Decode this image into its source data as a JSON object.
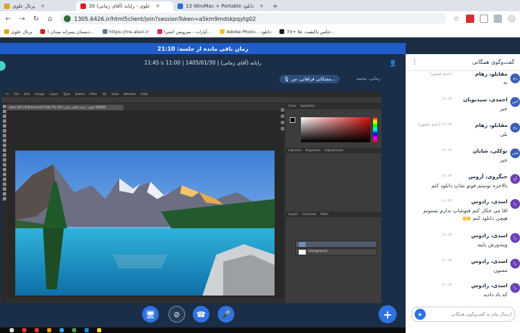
{
  "browser": {
    "tabs": [
      {
        "label": "پرتال علوی"
      },
      {
        "label": "علوی - رایانه (آقای زمانی) 30"
      },
      {
        "label": "13 Win/Mac + Portable دانلود"
      }
    ],
    "url": "1305.6426.ir/html5client/join?sessionToken=a5km9mdskpqytg02",
    "bookmarks": [
      {
        "label": "پرتال علوی"
      },
      {
        "label": "دبستان پسرانه میدان ا..."
      },
      {
        "label": "https://ms.alavi.ir"
      },
      {
        "label": "آپارات - سرویس اشترا..."
      },
      {
        "label": "Adobe Photo... دانلود"
      },
      {
        "label": "70+ عکس باکیفیت علا..."
      }
    ]
  },
  "session": {
    "remaining_label": "زمان باقی مانده از جلسه: 21:10",
    "info": "رایانه (آقای زمانی) | 1405/01/30 | 11:00 تا 11:45",
    "presenter_chip": "مشکانی فراهانی، س...",
    "presenter_name": "زمانی، محمد"
  },
  "photoshop": {
    "menu": [
      "File",
      "Edit",
      "Image",
      "Layer",
      "Type",
      "Select",
      "Filter",
      "3D",
      "View",
      "Window",
      "Help"
    ],
    "doc_tab": "alavi-38-1-0-Recovered 9-66.7% (علوی - رایانه (آقای زمانی) 30 RGB/8)",
    "panel_tabs_top": [
      "Color",
      "Swatches"
    ],
    "panel_tabs_mid": [
      "Libraries",
      "Properties",
      "Adjustments"
    ],
    "panel_tabs_bottom": [
      "Layers",
      "Channels",
      "Paths"
    ],
    "layer_background": "Background"
  },
  "chat": {
    "title": "گفت‌وگوی همگانی",
    "messages": [
      {
        "name": "مقانلو، رهام",
        "time": "(عدم حضور)",
        "text": "نه",
        "avatar": "رم"
      },
      {
        "name": "احمدی، سیدبویان",
        "time": "۱۱:۱۲",
        "text": "خیر",
        "avatar": "اس"
      },
      {
        "name": "مقانلو، رهام",
        "time": "۱۱:۱۲",
        "time_note": "(عدم حضور)",
        "text": "بلی",
        "avatar": "رم"
      },
      {
        "name": "نوکلی، شایان",
        "time": "۱۱:۱۲",
        "text": "خیر",
        "avatar": "شن"
      },
      {
        "name": "حنگروی، آروس",
        "time": "۱۱:۱۲",
        "text": "بالاخره نوستم فوتو شاپ دانلود کنم",
        "avatar": "آح"
      },
      {
        "name": "اسدی، رادوس",
        "time": "۱۱:۱۲",
        "text": "اقا می حکاز کنم فتوشاپ ندارم بمنتونم",
        "text2": "هیچی دانلود کنم",
        "avatar": "را"
      },
      {
        "name": "اسدی، رادوس",
        "time": "۱۱:۱۲",
        "text": "ویندورش بابیه",
        "avatar": "را"
      },
      {
        "name": "اسدی، رادوس",
        "time": "۱۱:۱۲",
        "text": "ممنون",
        "avatar": "را"
      },
      {
        "name": "اسدی، رادوس",
        "time": "۱۱:۱۲",
        "text": "که باد دادید",
        "avatar": "را"
      }
    ],
    "input_placeholder": "ارسال پیام به گفت‌وگوی همگانی"
  },
  "colors": {
    "accent": "#2f73e0",
    "stage_bg": "#1b2e47",
    "timer_bg": "#1f5ec8"
  },
  "icons": {
    "controls": [
      "screen-share-icon",
      "camera-off-icon",
      "phone-icon",
      "microphone-icon",
      "plus-icon"
    ]
  }
}
